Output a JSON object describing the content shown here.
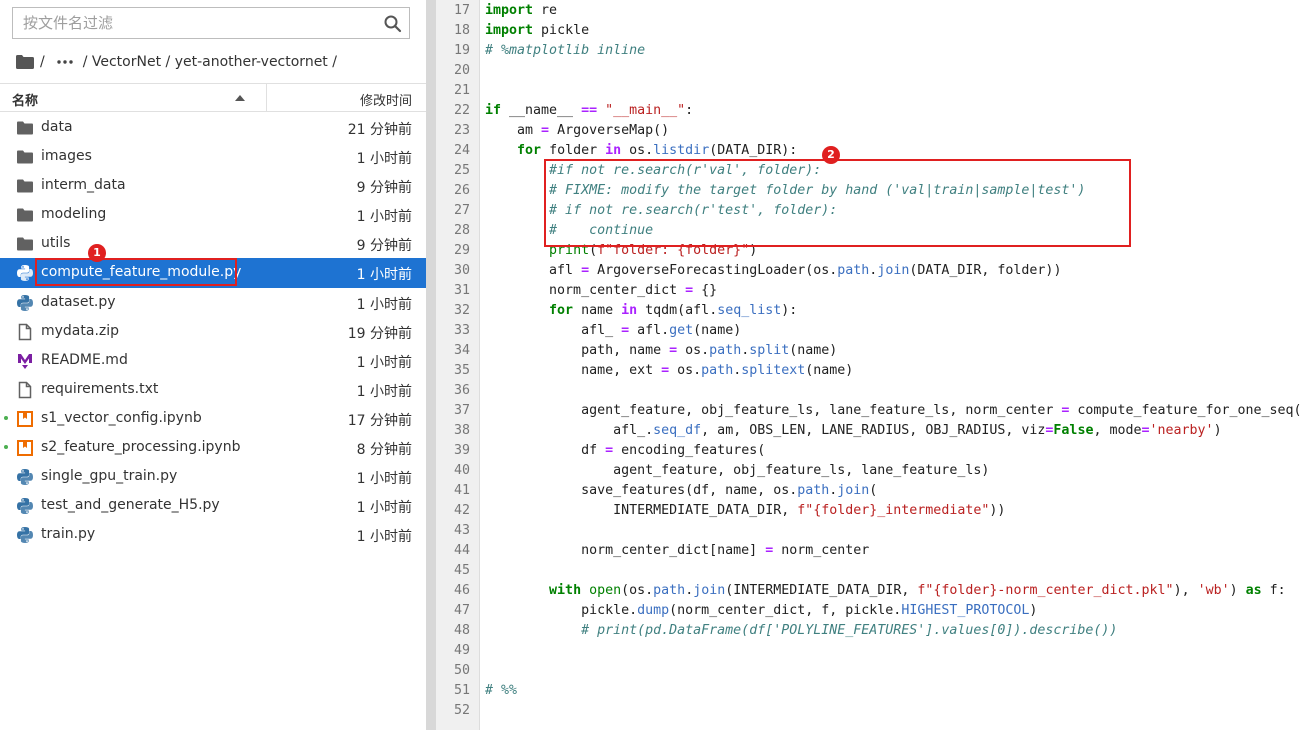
{
  "sidebar": {
    "search_placeholder": "按文件名过滤",
    "breadcrumb": {
      "sep1": "/",
      "path": "/ VectorNet / yet-another-vectornet /"
    },
    "header": {
      "name": "名称",
      "modified": "修改时间"
    },
    "files": [
      {
        "name": "data",
        "time": "21 分钟前",
        "icon": "folder-icon"
      },
      {
        "name": "images",
        "time": "1 小时前",
        "icon": "folder-icon"
      },
      {
        "name": "interm_data",
        "time": "9 分钟前",
        "icon": "folder-icon"
      },
      {
        "name": "modeling",
        "time": "1 小时前",
        "icon": "folder-icon"
      },
      {
        "name": "utils",
        "time": "9 分钟前",
        "icon": "folder-icon"
      },
      {
        "name": "compute_feature_module.py",
        "time": "1 小时前",
        "icon": "python-icon",
        "selected": true
      },
      {
        "name": "dataset.py",
        "time": "1 小时前",
        "icon": "python-icon"
      },
      {
        "name": "mydata.zip",
        "time": "19 分钟前",
        "icon": "file-icon"
      },
      {
        "name": "README.md",
        "time": "1 小时前",
        "icon": "markdown-icon"
      },
      {
        "name": "requirements.txt",
        "time": "1 小时前",
        "icon": "file-icon"
      },
      {
        "name": "s1_vector_config.ipynb",
        "time": "17 分钟前",
        "icon": "notebook-icon",
        "running": true
      },
      {
        "name": "s2_feature_processing.ipynb",
        "time": "8 分钟前",
        "icon": "notebook-icon",
        "running": true
      },
      {
        "name": "single_gpu_train.py",
        "time": "1 小时前",
        "icon": "python-icon"
      },
      {
        "name": "test_and_generate_H5.py",
        "time": "1 小时前",
        "icon": "python-icon"
      },
      {
        "name": "train.py",
        "time": "1 小时前",
        "icon": "python-icon"
      }
    ]
  },
  "annotations": {
    "badge1": "1",
    "badge2": "2"
  },
  "editor": {
    "lines": [
      {
        "n": "17",
        "t": [
          [
            "kw",
            "import"
          ],
          [
            "",
            " re"
          ]
        ]
      },
      {
        "n": "18",
        "t": [
          [
            "kw",
            "import"
          ],
          [
            "",
            " pickle"
          ]
        ]
      },
      {
        "n": "19",
        "t": [
          [
            "cm",
            "# %matplotlib inline"
          ]
        ]
      },
      {
        "n": "20",
        "t": []
      },
      {
        "n": "21",
        "t": []
      },
      {
        "n": "22",
        "t": [
          [
            "kw",
            "if"
          ],
          [
            "",
            " __name__ "
          ],
          [
            "op",
            "=="
          ],
          [
            "",
            " "
          ],
          [
            "st",
            "\"__main__\""
          ],
          [
            "",
            ":"
          ]
        ]
      },
      {
        "n": "23",
        "t": [
          [
            "",
            "    am "
          ],
          [
            "op",
            "="
          ],
          [
            "",
            " ArgoverseMap()"
          ]
        ]
      },
      {
        "n": "24",
        "t": [
          [
            "",
            "    "
          ],
          [
            "kw",
            "for"
          ],
          [
            "",
            " folder "
          ],
          [
            "op",
            "in"
          ],
          [
            "",
            " os."
          ],
          [
            "at",
            "listdir"
          ],
          [
            "",
            "(DATA_DIR):"
          ]
        ]
      },
      {
        "n": "25",
        "t": [
          [
            "",
            "        "
          ],
          [
            "cm",
            "#if not re.search(r'val', folder):"
          ]
        ]
      },
      {
        "n": "26",
        "t": [
          [
            "",
            "        "
          ],
          [
            "cm",
            "# FIXME: modify the target folder by hand ('val|train|sample|test')"
          ]
        ]
      },
      {
        "n": "27",
        "t": [
          [
            "",
            "        "
          ],
          [
            "cm",
            "# if not re.search(r'test', folder):"
          ]
        ]
      },
      {
        "n": "28",
        "t": [
          [
            "",
            "        "
          ],
          [
            "cm",
            "#    continue"
          ]
        ]
      },
      {
        "n": "29",
        "t": [
          [
            "",
            "        "
          ],
          [
            "bi",
            "print"
          ],
          [
            "",
            "("
          ],
          [
            "st",
            "f\"folder: {folder}\""
          ],
          [
            "",
            ")"
          ]
        ]
      },
      {
        "n": "30",
        "t": [
          [
            "",
            "        afl "
          ],
          [
            "op",
            "="
          ],
          [
            "",
            " ArgoverseForecastingLoader(os."
          ],
          [
            "at",
            "path"
          ],
          [
            "",
            "."
          ],
          [
            "at",
            "join"
          ],
          [
            "",
            "(DATA_DIR, folder))"
          ]
        ]
      },
      {
        "n": "31",
        "t": [
          [
            "",
            "        norm_center_dict "
          ],
          [
            "op",
            "="
          ],
          [
            "",
            " {}"
          ]
        ]
      },
      {
        "n": "32",
        "t": [
          [
            "",
            "        "
          ],
          [
            "kw",
            "for"
          ],
          [
            "",
            " name "
          ],
          [
            "op",
            "in"
          ],
          [
            "",
            " tqdm(afl."
          ],
          [
            "at",
            "seq_list"
          ],
          [
            "",
            "):"
          ]
        ]
      },
      {
        "n": "33",
        "t": [
          [
            "",
            "            afl_ "
          ],
          [
            "op",
            "="
          ],
          [
            "",
            " afl."
          ],
          [
            "at",
            "get"
          ],
          [
            "",
            "(name)"
          ]
        ]
      },
      {
        "n": "34",
        "t": [
          [
            "",
            "            path, name "
          ],
          [
            "op",
            "="
          ],
          [
            "",
            " os."
          ],
          [
            "at",
            "path"
          ],
          [
            "",
            "."
          ],
          [
            "at",
            "split"
          ],
          [
            "",
            "(name)"
          ]
        ]
      },
      {
        "n": "35",
        "t": [
          [
            "",
            "            name, ext "
          ],
          [
            "op",
            "="
          ],
          [
            "",
            " os."
          ],
          [
            "at",
            "path"
          ],
          [
            "",
            "."
          ],
          [
            "at",
            "splitext"
          ],
          [
            "",
            "(name)"
          ]
        ]
      },
      {
        "n": "36",
        "t": []
      },
      {
        "n": "37",
        "t": [
          [
            "",
            "            agent_feature, obj_feature_ls, lane_feature_ls, norm_center "
          ],
          [
            "op",
            "="
          ],
          [
            "",
            " compute_feature_for_one_seq("
          ]
        ]
      },
      {
        "n": "38",
        "t": [
          [
            "",
            "                afl_."
          ],
          [
            "at",
            "seq_df"
          ],
          [
            "",
            ", am, OBS_LEN, LANE_RADIUS, OBJ_RADIUS, viz"
          ],
          [
            "op",
            "="
          ],
          [
            "kw",
            "False"
          ],
          [
            "",
            ", mode"
          ],
          [
            "op",
            "="
          ],
          [
            "st",
            "'nearby'"
          ],
          [
            "",
            ")"
          ]
        ]
      },
      {
        "n": "39",
        "t": [
          [
            "",
            "            df "
          ],
          [
            "op",
            "="
          ],
          [
            "",
            " encoding_features("
          ]
        ]
      },
      {
        "n": "40",
        "t": [
          [
            "",
            "                agent_feature, obj_feature_ls, lane_feature_ls)"
          ]
        ]
      },
      {
        "n": "41",
        "t": [
          [
            "",
            "            save_features(df, name, os."
          ],
          [
            "at",
            "path"
          ],
          [
            "",
            "."
          ],
          [
            "at",
            "join"
          ],
          [
            "",
            "("
          ]
        ]
      },
      {
        "n": "42",
        "t": [
          [
            "",
            "                INTERMEDIATE_DATA_DIR, "
          ],
          [
            "st",
            "f\"{folder}_intermediate\""
          ],
          [
            "",
            "))"
          ]
        ]
      },
      {
        "n": "43",
        "t": []
      },
      {
        "n": "44",
        "t": [
          [
            "",
            "            norm_center_dict[name] "
          ],
          [
            "op",
            "="
          ],
          [
            "",
            " norm_center"
          ]
        ]
      },
      {
        "n": "45",
        "t": []
      },
      {
        "n": "46",
        "t": [
          [
            "",
            "        "
          ],
          [
            "kw",
            "with"
          ],
          [
            "",
            " "
          ],
          [
            "bi",
            "open"
          ],
          [
            "",
            "(os."
          ],
          [
            "at",
            "path"
          ],
          [
            "",
            "."
          ],
          [
            "at",
            "join"
          ],
          [
            "",
            "(INTERMEDIATE_DATA_DIR, "
          ],
          [
            "st",
            "f\"{folder}-norm_center_dict.pkl\""
          ],
          [
            "",
            "), "
          ],
          [
            "st",
            "'wb'"
          ],
          [
            "",
            ") "
          ],
          [
            "kw",
            "as"
          ],
          [
            "",
            " f:"
          ]
        ]
      },
      {
        "n": "47",
        "t": [
          [
            "",
            "            pickle."
          ],
          [
            "at",
            "dump"
          ],
          [
            "",
            "(norm_center_dict, f, pickle."
          ],
          [
            "at",
            "HIGHEST_PROTOCOL"
          ],
          [
            "",
            ")"
          ]
        ]
      },
      {
        "n": "48",
        "t": [
          [
            "",
            "            "
          ],
          [
            "cm",
            "# print(pd.DataFrame(df['POLYLINE_FEATURES'].values[0]).describe())"
          ]
        ]
      },
      {
        "n": "49",
        "t": []
      },
      {
        "n": "50",
        "t": []
      },
      {
        "n": "51",
        "t": [
          [
            "cm",
            "# %%"
          ]
        ]
      },
      {
        "n": "52",
        "t": []
      }
    ]
  },
  "colors": {
    "selection": "#1e73d2",
    "annotation": "#e02020",
    "keyword": "#008000",
    "comment": "#408080",
    "string": "#ba2121"
  }
}
